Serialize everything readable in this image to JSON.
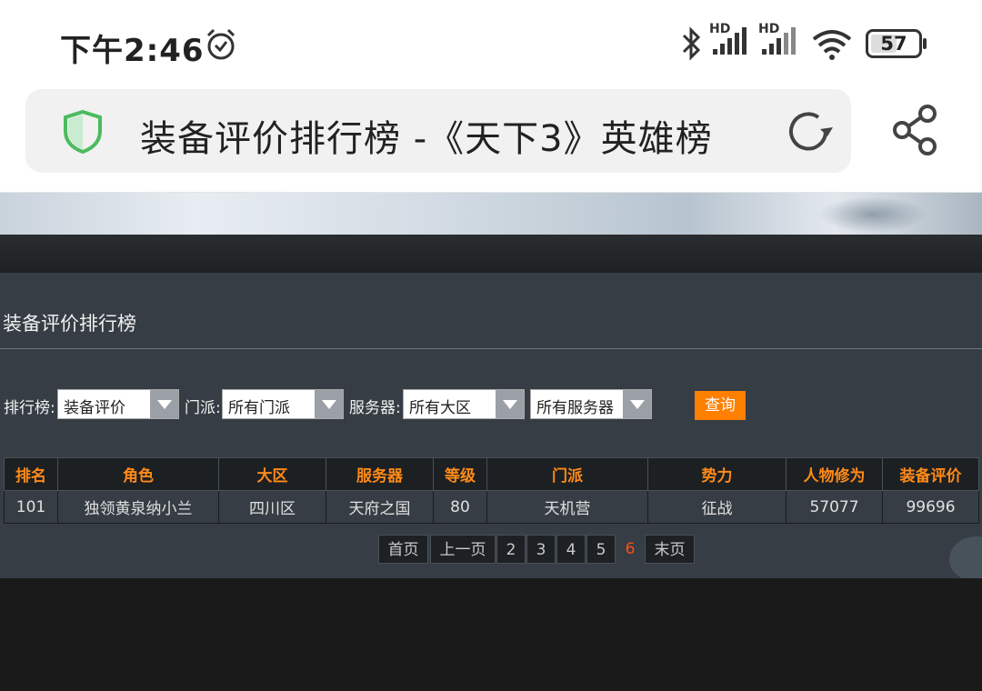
{
  "status": {
    "time": "下午2:46",
    "battery": "57",
    "battery_level": 0.57,
    "network1": "HD",
    "network2": "HD"
  },
  "browser": {
    "title": "装备评价排行榜 -《天下3》英雄榜"
  },
  "section": {
    "title": "装备评价排行榜"
  },
  "filters": {
    "rank_label": "排行榜:",
    "rank_value": "装备评价",
    "school_label": "门派:",
    "school_value": "所有门派",
    "server_label": "服务器:",
    "region_value": "所有大区",
    "server_value": "所有服务器",
    "query_label": "查询"
  },
  "table": {
    "headers": [
      "排名",
      "角色",
      "大区",
      "服务器",
      "等级",
      "门派",
      "势力",
      "人物修为",
      "装备评价"
    ],
    "rows": [
      [
        "101",
        "独领黄泉纳小兰",
        "四川区",
        "天府之国",
        "80",
        "天机营",
        "征战",
        "57077",
        "99696"
      ]
    ]
  },
  "pager": {
    "first": "首页",
    "prev": "上一页",
    "pages": [
      "2",
      "3",
      "4",
      "5"
    ],
    "current": "6",
    "last": "末页"
  },
  "colors": {
    "accent": "#ff7f00",
    "header_text": "#ff8a18",
    "current_page": "#ff4d1a",
    "shield": "#4cbb5e"
  }
}
